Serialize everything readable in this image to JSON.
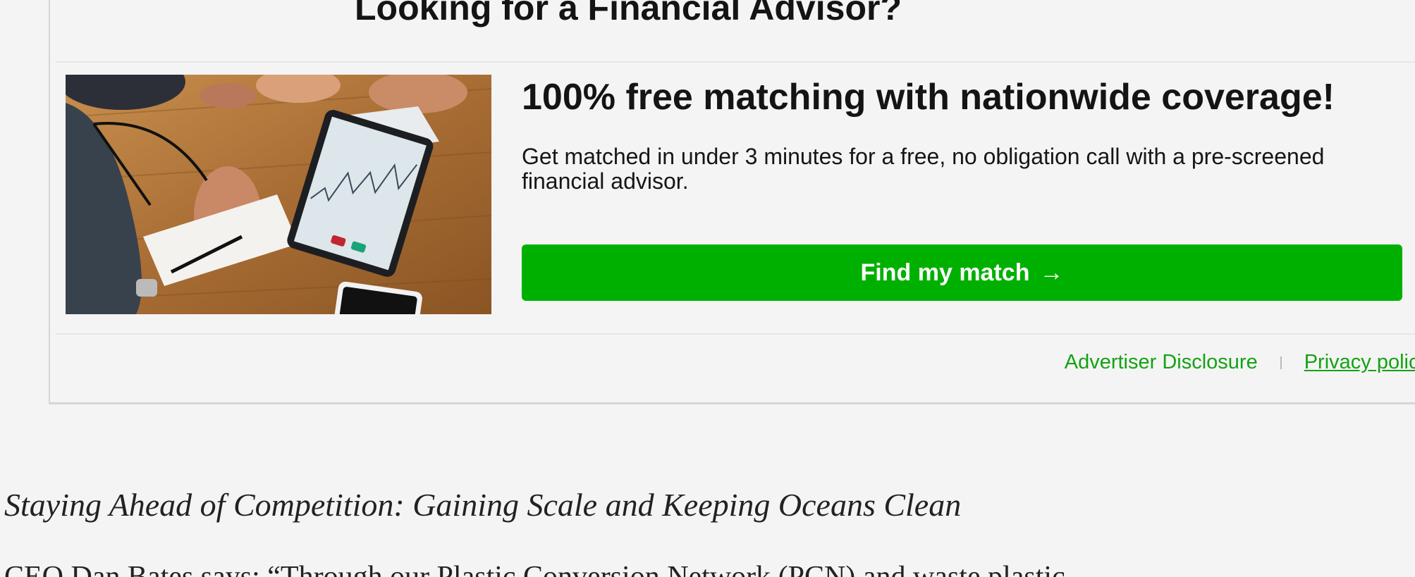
{
  "ad": {
    "heading": "Looking for a Financial Advisor?",
    "title": "100% free matching with nationwide coverage!",
    "description": "Get matched in under 3 minutes for a free, no obligation call with a pre-screened financial advisor.",
    "cta_label": "Find my match",
    "cta_arrow": "→",
    "links": {
      "advertiser_disclosure": "Advertiser Disclosure",
      "privacy_policy": "Privacy policy"
    },
    "colors": {
      "cta": "#00b000",
      "link": "#14a214"
    }
  },
  "article": {
    "subheading": "Staying Ahead of Competition: Gaining Scale and Keeping Oceans Clean",
    "paragraph_start": "CEO Dan Bates says: “Through our Plastic Conversion Network (PCN) and waste plastic"
  }
}
